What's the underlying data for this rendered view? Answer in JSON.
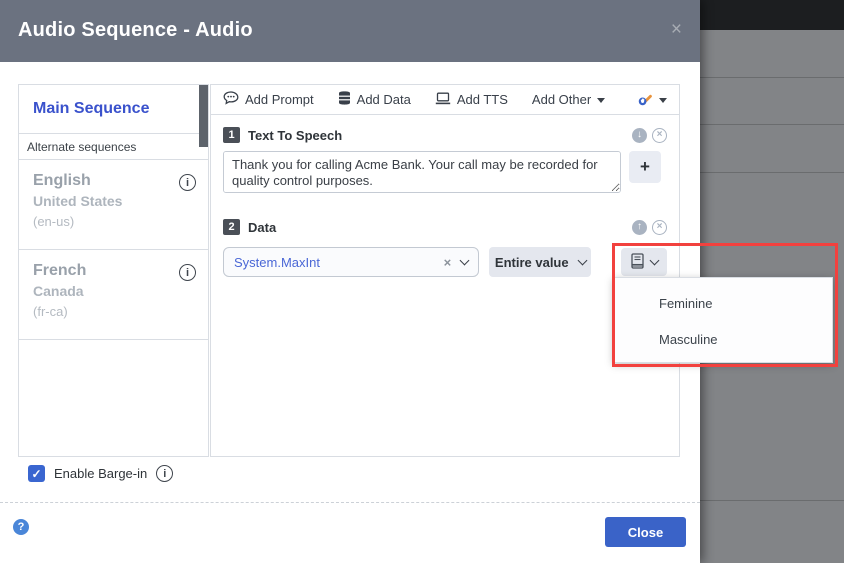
{
  "modal": {
    "title": "Audio Sequence - Audio",
    "close_glyph": "×"
  },
  "sidebar": {
    "main_item": "Main Sequence",
    "alternate_label": "Alternate sequences",
    "languages": [
      {
        "name": "English",
        "region": "United States",
        "code": "(en-us)",
        "info_glyph": "i"
      },
      {
        "name": "French",
        "region": "Canada",
        "code": "(fr-ca)",
        "info_glyph": "i"
      }
    ]
  },
  "toolbar": {
    "add_prompt": "Add Prompt",
    "add_data": "Add Data",
    "add_tts": "Add TTS",
    "add_other": "Add Other"
  },
  "sections": [
    {
      "number": "1",
      "title": "Text To Speech",
      "text": "Thank you for calling Acme Bank. Your call may be recorded for quality control purposes.",
      "move_glyph": "↓",
      "remove_glyph": "×",
      "add_button": "+"
    },
    {
      "number": "2",
      "title": "Data",
      "value": "System.MaxInt",
      "clear_glyph": "×",
      "mode_label": "Entire value",
      "move_glyph": "↑",
      "remove_glyph": "×"
    }
  ],
  "gender_menu": {
    "items": [
      "Feminine",
      "Masculine"
    ]
  },
  "barge": {
    "label": "Enable Barge-in",
    "checked_glyph": "✓",
    "info_glyph": "i"
  },
  "footer": {
    "help_glyph": "?",
    "close_label": "Close"
  },
  "colors": {
    "accent_blue": "#3a52cc",
    "close_button_blue": "#3a63c8",
    "header_gray": "#6b7280",
    "backdrop_gray": "#828487",
    "annotation_red": "#f2413e",
    "wrench_orange": "#e8933c",
    "wrench_blue": "#3a63c8"
  }
}
